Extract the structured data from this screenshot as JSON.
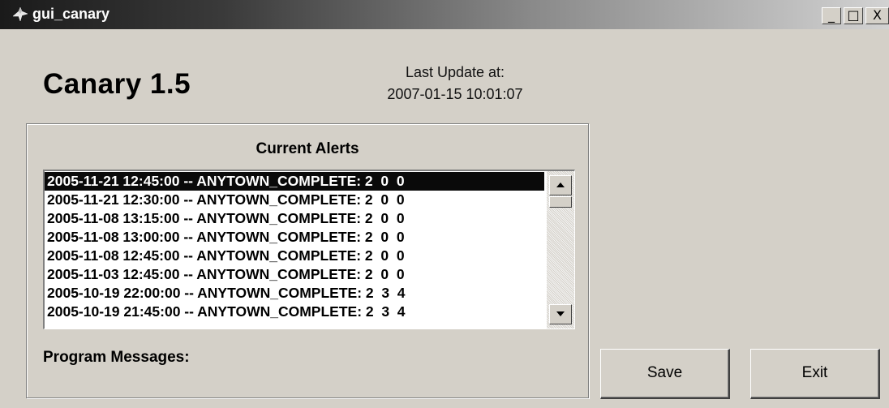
{
  "window": {
    "title": "gui_canary",
    "controls": {
      "minimize": "_",
      "maximize": "□",
      "close": "X"
    }
  },
  "header": {
    "app_title": "Canary 1.5",
    "last_update_label": "Last Update at:",
    "last_update_value": "2007-01-15 10:01:07"
  },
  "alerts_panel": {
    "heading": "Current Alerts",
    "items": [
      "2005-11-21 12:45:00 -- ANYTOWN_COMPLETE: 2  0  0",
      "2005-11-21 12:30:00 -- ANYTOWN_COMPLETE: 2  0  0",
      "2005-11-08 13:15:00 -- ANYTOWN_COMPLETE: 2  0  0",
      "2005-11-08 13:00:00 -- ANYTOWN_COMPLETE: 2  0  0",
      "2005-11-08 12:45:00 -- ANYTOWN_COMPLETE: 2  0  0",
      "2005-11-03 12:45:00 -- ANYTOWN_COMPLETE: 2  0  0",
      "2005-10-19 22:00:00 -- ANYTOWN_COMPLETE: 2  3  4",
      "2005-10-19 21:45:00 -- ANYTOWN_COMPLETE: 2  3  4"
    ],
    "selected_index": 0,
    "messages_label": "Program Messages:"
  },
  "buttons": {
    "save": "Save",
    "exit": "Exit"
  },
  "colors": {
    "window_bg": "#d4d0c8",
    "selection_bg": "#0a0a0a",
    "selection_text": "#ffffff",
    "list_bg": "#ffffff"
  },
  "icons": {
    "title_icon": "canary-bird-icon",
    "scroll_up": "arrow-up-icon",
    "scroll_down": "arrow-down-icon"
  }
}
